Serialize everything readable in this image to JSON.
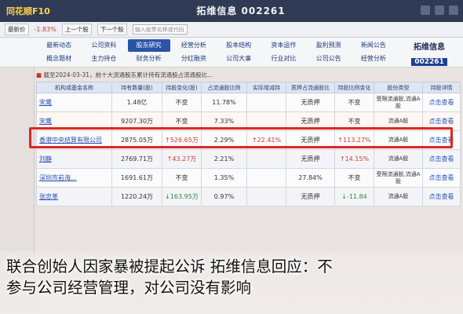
{
  "app": {
    "brand": "同花顺F10",
    "title": "拓维信息 002261"
  },
  "toolbar": {
    "search_placeholder": "输入股票名称或代码",
    "prev_label": "上一个股",
    "next_label": "下一个股",
    "change_text": "-1.83%",
    "latest_label": "最新价"
  },
  "stock": {
    "name": "拓维信息",
    "code": "002261"
  },
  "nav": {
    "row1": [
      "最新动态",
      "公司资料",
      "股东研究",
      "经营分析",
      "股本结构",
      "资本运作",
      "盈利预测",
      "新闻公告"
    ],
    "row2": [
      "概念题材",
      "主力持仓",
      "财务分析",
      "分红融资",
      "公司大事",
      "行业对比",
      "公司公告",
      "经营分析"
    ],
    "active_index": 2
  },
  "notice": "截至2024-03-31，前十大流通股东累计持有流通股占流通股比...",
  "table": {
    "headers": [
      "机构或基金名称",
      "持有数量(股)",
      "持股变化(股)",
      "占流通股比例",
      "实际增减持",
      "质押占流通股比",
      "持股比例变化",
      "股份类型",
      "持股详情"
    ],
    "rows": [
      {
        "holder": "宋鹰",
        "qty": "1.48亿",
        "change": "不变",
        "pct": "11.78%",
        "act": "",
        "pledge": "无质押",
        "pctchg": "不变",
        "type": "受限流通股,流通A股",
        "detail": "点击查看",
        "cls": ""
      },
      {
        "holder": "宋鹰",
        "qty": "9207.30万",
        "change": "不变",
        "pct": "7.33%",
        "act": "",
        "pledge": "无质押",
        "pctchg": "不变",
        "type": "流通A股",
        "detail": "点击查看",
        "cls": "hl"
      },
      {
        "holder": "香港中央结算有限公司",
        "qty": "2875.05万",
        "change": "↑526.65万",
        "pct": "2.29%",
        "act": "↑22.41%",
        "pledge": "无质押",
        "pctchg": "↑113.27%",
        "type": "流通A股",
        "detail": "点击查看",
        "cls": "up"
      },
      {
        "holder": "刘静",
        "qty": "2769.71万",
        "change": "↑43.27万",
        "pct": "2.21%",
        "act": "",
        "pledge": "无质押",
        "pctchg": "↑14.15%",
        "type": "流通A股",
        "detail": "点击查看",
        "cls": "up"
      },
      {
        "holder": "深圳市前海...",
        "qty": "1691.61万",
        "change": "不变",
        "pct": "1.35%",
        "act": "",
        "pledge": "27.84%",
        "pctchg": "不变",
        "type": "受限流通股,流通A股",
        "detail": "点击查看",
        "cls": ""
      },
      {
        "holder": "张忠革",
        "qty": "1220.24万",
        "change": "↓163.95万",
        "pct": "0.97%",
        "act": "",
        "pledge": "无质押",
        "pctchg": "↓-11.84",
        "type": "流通A股",
        "detail": "点击查看",
        "cls": "down"
      }
    ]
  },
  "caption": {
    "line1": "联合创始人因家暴被提起公诉  拓维信息回应：不",
    "line2": "参与公司经营管理，对公司没有影响"
  },
  "colors": {
    "highlight": "#e02621",
    "up": "#d63a2c",
    "down": "#2b8a3e",
    "accent": "#2a54a8"
  }
}
